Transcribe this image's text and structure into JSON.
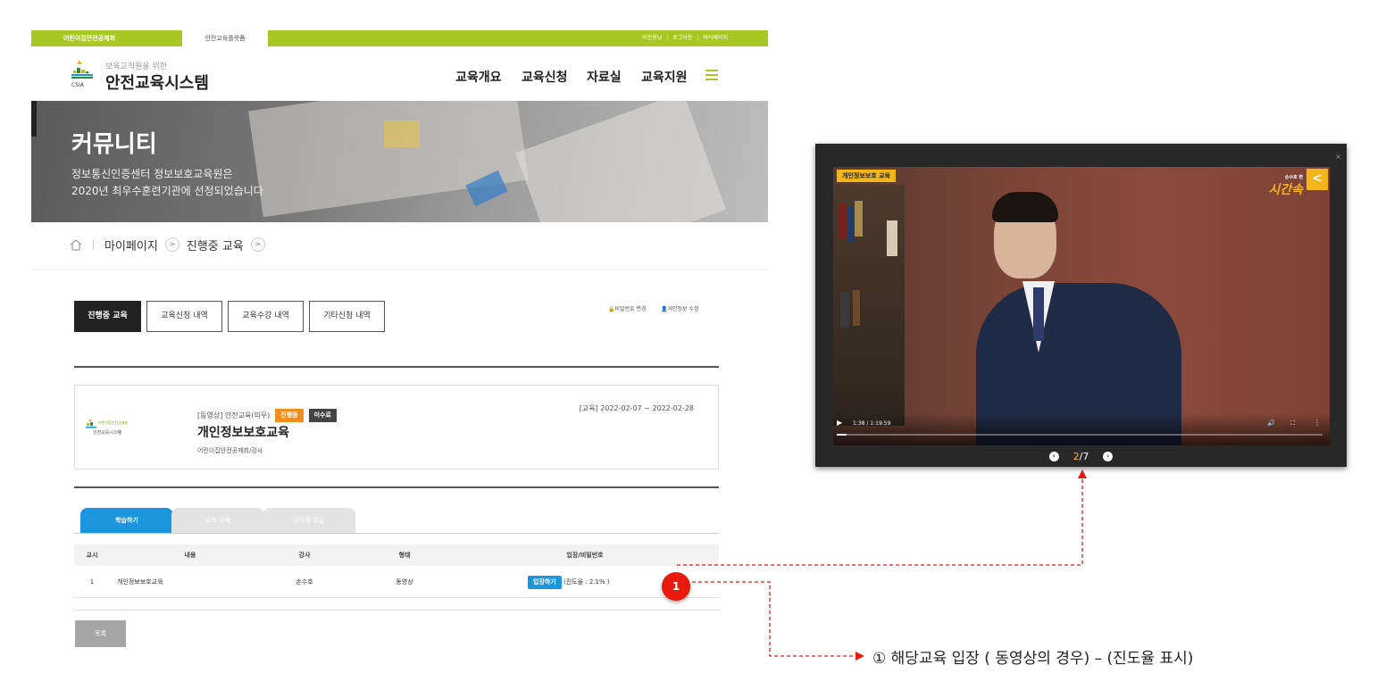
{
  "topbar": {
    "site_tab": "어린이집안전공제회",
    "platform_tab": "안전교육플랫폼",
    "user": "어린용님",
    "logout": "로그아웃",
    "mypage": "마이페이지"
  },
  "header": {
    "logo_sub": "보육교직원을 위한",
    "logo_main": "안전교육시스템",
    "logo_abbr": "CSIA",
    "nav": [
      "교육개요",
      "교육신청",
      "자료실",
      "교육지원"
    ]
  },
  "banner": {
    "title": "커뮤니티",
    "line1": "정보통신인증센터 정보보호교육원은",
    "line2": "2020년 최우수훈련기관에 선정되었습니다"
  },
  "breadcrumb": [
    "마이페이지",
    "진행중 교육"
  ],
  "tabs": [
    "진행중 교육",
    "교육신청 내역",
    "교육수강 내역",
    "기타신청 내역"
  ],
  "account": {
    "password": "비밀번호 변경",
    "profile": "개인정보 수정"
  },
  "course": {
    "logo_line1": "어린이집안전공제회",
    "logo_line2": "안전교육시스템",
    "category": "[동영상] 안전교육(의무)",
    "status_progress": "진행중",
    "status_complete": "미수료",
    "title": "개인정보보호교육",
    "instructor": "어린이집안전공제회/강사",
    "period": "[교육] 2022-02-07 ~ 2022-02-28"
  },
  "lower_tabs": [
    "학습하기",
    "교육 상세",
    "수료증 발급"
  ],
  "table": {
    "headers": [
      "교시",
      "내용",
      "강사",
      "형태",
      "입장/비밀번호"
    ],
    "rows": [
      {
        "period": "1",
        "content": "개인정보보호교육",
        "instructor": "손수호",
        "type": "동영상",
        "enter": "입장하기",
        "progress": "(진도율 : 2.1% )"
      }
    ]
  },
  "list_button": "목록",
  "marker": "1",
  "caption": "① 해당교육 입장 ( 동영상의 경우) – (진도율 표시)",
  "video": {
    "tag": "개인정보보호 교육",
    "brand_small": "손수호 변",
    "brand": "시간속",
    "back": "<",
    "close": "×",
    "time": "1:38 / 1:19:59",
    "progress_fraction": 0.021,
    "page_current": "2",
    "page_total": "/7"
  },
  "colors": {
    "brand_green": "#a8c722",
    "accent_blue": "#1a95de",
    "badge_orange": "#f28c1c",
    "marker_red": "#e8190d",
    "video_yellow": "#f2b51a"
  }
}
